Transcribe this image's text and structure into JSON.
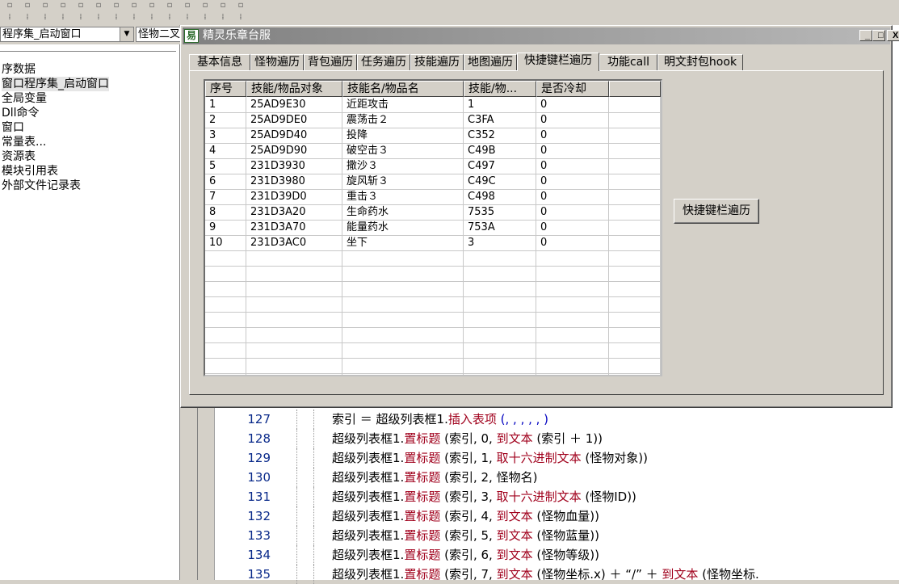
{
  "ide": {
    "combo_left": "程序集_启动窗口",
    "combo_right": "怪物二叉",
    "tree_items": [
      "序数据",
      "窗口程序集_启动窗口",
      "全局变量",
      "Dll命令",
      "窗口",
      "常量表...",
      "资源表",
      "模块引用表",
      "外部文件记录表"
    ],
    "code_lines": [
      {
        "num": "127",
        "parts": [
          [
            "索引 ＝ 超级列表框1.",
            ""
          ],
          [
            "插入表项",
            "m"
          ],
          [
            " (, , , , , )",
            "b"
          ]
        ]
      },
      {
        "num": "128",
        "parts": [
          [
            "超级列表框1.",
            ""
          ],
          [
            "置标题",
            "m"
          ],
          [
            " (索引, 0, ",
            ""
          ],
          [
            "到文本",
            "m"
          ],
          [
            " (索引 ＋ 1))",
            ""
          ]
        ]
      },
      {
        "num": "129",
        "parts": [
          [
            "超级列表框1.",
            ""
          ],
          [
            "置标题",
            "m"
          ],
          [
            " (索引, 1, ",
            ""
          ],
          [
            "取十六进制文本",
            "m"
          ],
          [
            " (怪物对象))",
            ""
          ]
        ]
      },
      {
        "num": "130",
        "parts": [
          [
            "超级列表框1.",
            ""
          ],
          [
            "置标题",
            "m"
          ],
          [
            " (索引, 2, 怪物名)",
            ""
          ]
        ]
      },
      {
        "num": "131",
        "parts": [
          [
            "超级列表框1.",
            ""
          ],
          [
            "置标题",
            "m"
          ],
          [
            " (索引, 3, ",
            ""
          ],
          [
            "取十六进制文本",
            "m"
          ],
          [
            " (怪物ID))",
            ""
          ]
        ]
      },
      {
        "num": "132",
        "parts": [
          [
            "超级列表框1.",
            ""
          ],
          [
            "置标题",
            "m"
          ],
          [
            " (索引, 4, ",
            ""
          ],
          [
            "到文本",
            "m"
          ],
          [
            " (怪物血量))",
            ""
          ]
        ]
      },
      {
        "num": "133",
        "parts": [
          [
            "超级列表框1.",
            ""
          ],
          [
            "置标题",
            "m"
          ],
          [
            " (索引, 5, ",
            ""
          ],
          [
            "到文本",
            "m"
          ],
          [
            " (怪物蓝量))",
            ""
          ]
        ]
      },
      {
        "num": "134",
        "parts": [
          [
            "超级列表框1.",
            ""
          ],
          [
            "置标题",
            "m"
          ],
          [
            " (索引, 6, ",
            ""
          ],
          [
            "到文本",
            "m"
          ],
          [
            " (怪物等级))",
            ""
          ]
        ]
      },
      {
        "num": "135",
        "parts": [
          [
            "超级列表框1.",
            ""
          ],
          [
            "置标题",
            "m"
          ],
          [
            " (索引, 7, ",
            ""
          ],
          [
            "到文本",
            "m"
          ],
          [
            " (怪物坐标.x) ＋ “/” ＋ ",
            ""
          ],
          [
            "到文本",
            "m"
          ],
          [
            " (怪物坐标.",
            ""
          ]
        ]
      }
    ]
  },
  "window": {
    "title": "精灵乐章台服",
    "icon_glyph": "易",
    "minimize": "_",
    "maximize": "□",
    "close": "X",
    "tabs": [
      "基本信息",
      "怪物遍历",
      "背包遍历",
      "任务遍历",
      "技能遍历",
      "地图遍历",
      "快捷键栏遍历",
      "功能call",
      "明文封包hook"
    ],
    "active_tab": 6,
    "list": {
      "columns": [
        "序号",
        "技能/物品对象",
        "技能名/物品名",
        "技能/物...",
        "是否冷却"
      ],
      "rows": [
        [
          "1",
          "25AD9E30",
          "近距攻击",
          "1",
          "0"
        ],
        [
          "2",
          "25AD9DE0",
          "震荡击２",
          "C3FA",
          "0"
        ],
        [
          "3",
          "25AD9D40",
          "投降",
          "C352",
          "0"
        ],
        [
          "4",
          "25AD9D90",
          "破空击３",
          "C49B",
          "0"
        ],
        [
          "5",
          "231D3930",
          "撒沙３",
          "C497",
          "0"
        ],
        [
          "6",
          "231D3980",
          "旋风斩３",
          "C49C",
          "0"
        ],
        [
          "7",
          "231D39D0",
          "重击３",
          "C498",
          "0"
        ],
        [
          "8",
          "231D3A20",
          "生命药水",
          "7535",
          "0"
        ],
        [
          "9",
          "231D3A70",
          "能量药水",
          "753A",
          "0"
        ],
        [
          "10",
          "231D3AC0",
          "坐下",
          "3",
          "0"
        ]
      ]
    },
    "action_button": "快捷键栏遍历"
  }
}
